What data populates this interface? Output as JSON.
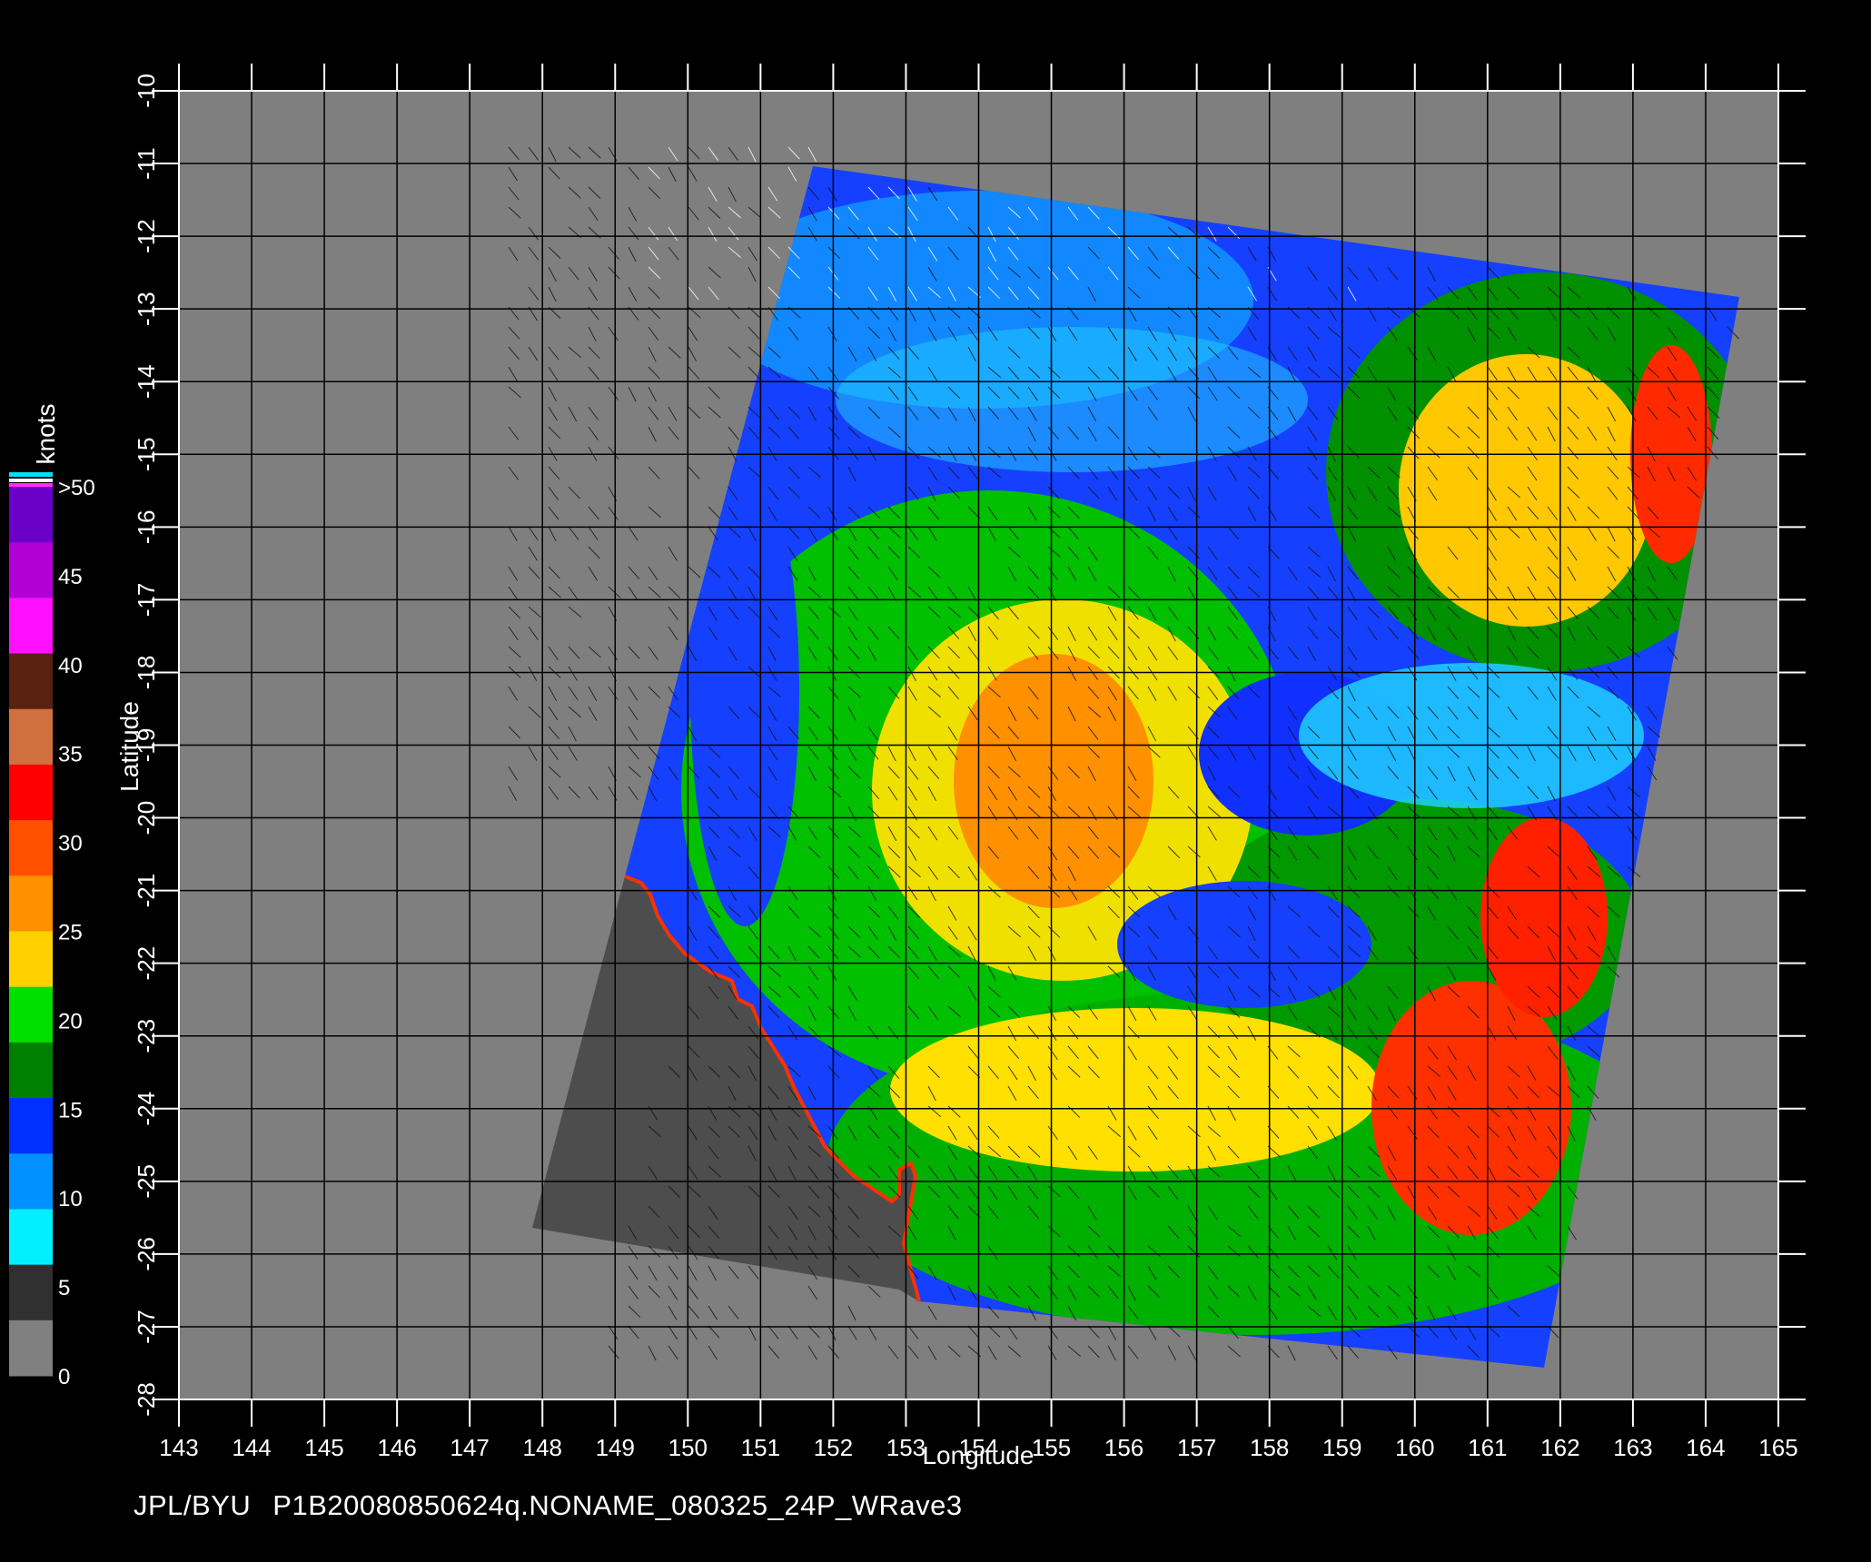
{
  "map": {
    "x_label": "Longitude",
    "y_label": "Latitude",
    "lon_range": [
      143,
      165
    ],
    "lat_range": [
      -28,
      -10
    ],
    "lon_ticks": [
      143,
      144,
      145,
      146,
      147,
      148,
      149,
      150,
      151,
      152,
      153,
      154,
      155,
      156,
      157,
      158,
      159,
      160,
      161,
      162,
      163,
      164,
      165
    ],
    "lat_ticks": [
      -10,
      -11,
      -12,
      -13,
      -14,
      -15,
      -16,
      -17,
      -18,
      -19,
      -20,
      -21,
      -22,
      -23,
      -24,
      -25,
      -26,
      -27,
      -28
    ],
    "background_color": "#7f7f7f",
    "land_color": "#4d4d4d",
    "grid_color": "#000000"
  },
  "colorbar": {
    "unit": "knots",
    "labels": [
      ">50",
      "45",
      "40",
      "35",
      "30",
      "25",
      "20",
      "15",
      "10",
      "5",
      "0"
    ],
    "colors": [
      "#6a00c8",
      "#b000d4",
      "#ff10ff",
      "#5a2010",
      "#d07040",
      "#ff0000",
      "#ff5000",
      "#ff9000",
      "#ffd000",
      "#00e000",
      "#008000",
      "#0030ff",
      "#0090ff",
      "#00f0ff",
      "#303030",
      "#808080"
    ]
  },
  "footer": {
    "source": "JPL/BYU",
    "file": "P1B20080850624q.NONAME_080325_24P_WRave3"
  }
}
